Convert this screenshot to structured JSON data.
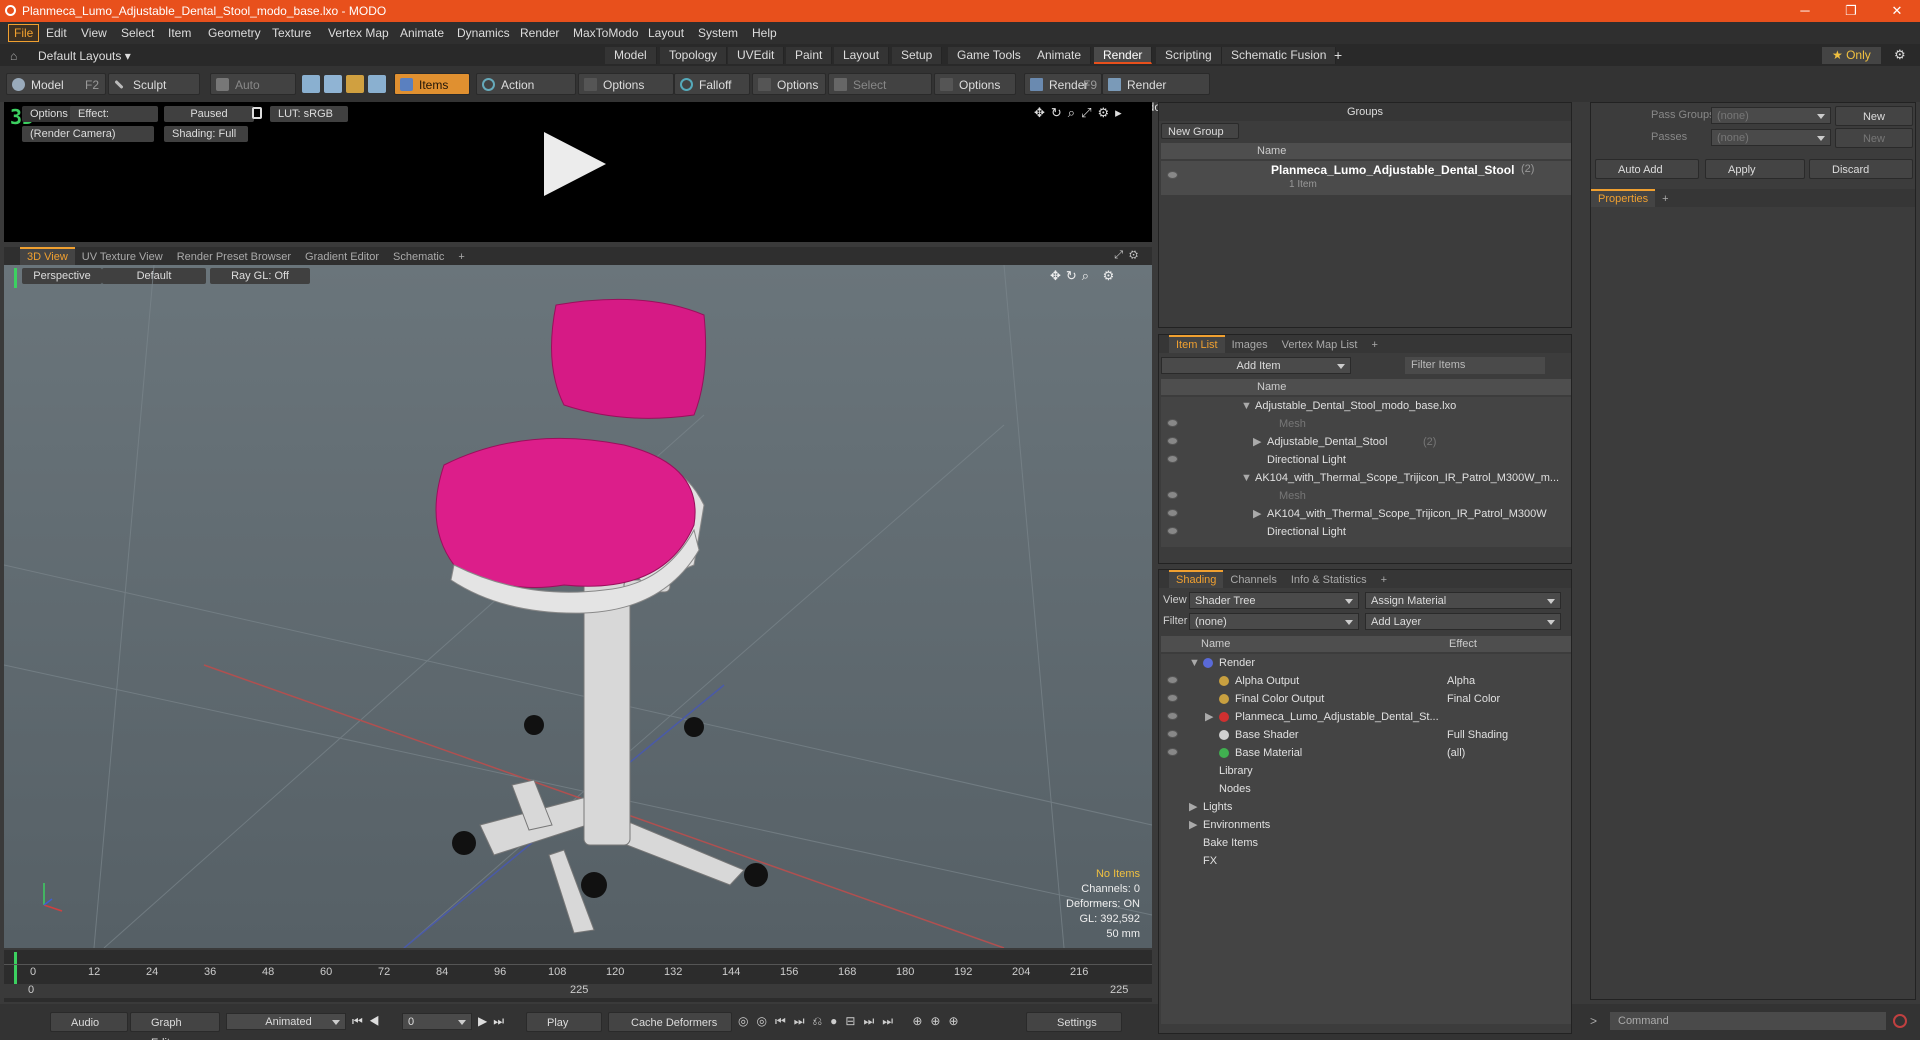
{
  "titlebar": {
    "title": "Planmeca_Lumo_Adjustable_Dental_Stool_modo_base.lxo - MODO",
    "min": "─",
    "max": "❐",
    "close": "✕"
  },
  "menu": [
    "File",
    "Edit",
    "View",
    "Select",
    "Item",
    "Geometry",
    "Texture",
    "Vertex Map",
    "Animate",
    "Dynamics",
    "Render",
    "MaxToModo",
    "Layout",
    "System",
    "Help"
  ],
  "layouts": {
    "label": "Default Layouts ▾",
    "tabs": [
      "Model",
      "Topology",
      "UVEdit",
      "Paint",
      "Layout",
      "Setup",
      "Game Tools",
      "Animate",
      "Render",
      "Scripting",
      "Schematic Fusion"
    ],
    "active": "Render",
    "only": "★ Only"
  },
  "toolbar": {
    "model": "Model",
    "model_key": "F2",
    "sculpt": "Sculpt",
    "auto_select": "Auto Select",
    "items": "Items",
    "action_center": "Action Center",
    "options1": "Options",
    "falloff": "Falloff",
    "options2": "Options",
    "select_through": "Select Through",
    "options3": "Options",
    "render": "Render",
    "render_key": "F9",
    "render_window": "Render Window"
  },
  "preview": {
    "options": "Options",
    "effect": "Effect: (Shadi...",
    "paused": "Paused",
    "lut": "LUT: sRGB",
    "camera": "(Render Camera)",
    "shading": "Shading: Full"
  },
  "viewtabs": [
    "3D View",
    "UV Texture View",
    "Render Preset Browser",
    "Gradient Editor",
    "Schematic"
  ],
  "viewport": {
    "perspective": "Perspective",
    "default": "Default",
    "raygl": "Ray GL: Off",
    "no_items": "No Items",
    "channels": "Channels: 0",
    "deformers": "Deformers: ON",
    "gl": "GL: 392,592",
    "mm": "50 mm"
  },
  "timeline": {
    "ticks": [
      "0",
      "12",
      "24",
      "36",
      "48",
      "60",
      "72",
      "84",
      "96",
      "108",
      "120",
      "132",
      "144",
      "156",
      "168",
      "180",
      "192",
      "204",
      "216"
    ],
    "start": "0",
    "mid": "225",
    "end": "225"
  },
  "bottombar": {
    "audio": "Audio",
    "graph": "Graph Editor",
    "animated": "Animated",
    "frame": "0",
    "play": "Play",
    "cache": "Cache Deformers",
    "settings": "Settings",
    "command": "Command"
  },
  "groups": {
    "title": "Groups",
    "new_group": "New Group",
    "name_col": "Name",
    "item_name": "Planmeca_Lumo_Adjustable_Dental_Stool",
    "item_count": "(2)",
    "item_sub": "1 Item"
  },
  "passes": {
    "pass_groups": "Pass Groups",
    "passes": "Passes",
    "none1": "(none)",
    "none2": "(none)",
    "new1": "New",
    "new2": "New",
    "auto_add": "Auto Add",
    "apply": "Apply",
    "discard": "Discard",
    "properties": "Properties"
  },
  "itemlist": {
    "tabs": [
      "Item List",
      "Images",
      "Vertex Map List"
    ],
    "add_item": "Add Item",
    "filter": "Filter Items",
    "name_col": "Name",
    "rows": [
      {
        "t": "Adjustable_Dental_Stool_modo_base.lxo",
        "lvl": 0,
        "arrow": "▼",
        "dim": false,
        "eye": false
      },
      {
        "t": "Mesh",
        "lvl": 2,
        "arrow": "",
        "dim": true,
        "eye": true
      },
      {
        "t": "Adjustable_Dental_Stool",
        "c": "(2)",
        "lvl": 1,
        "arrow": "▶",
        "dim": false,
        "eye": true
      },
      {
        "t": "Directional Light",
        "lvl": 1,
        "arrow": "",
        "dim": false,
        "eye": true
      },
      {
        "t": "AK104_with_Thermal_Scope_Trijicon_IR_Patrol_M300W_m...",
        "lvl": 0,
        "arrow": "▼",
        "dim": false,
        "eye": false
      },
      {
        "t": "Mesh",
        "lvl": 2,
        "arrow": "",
        "dim": true,
        "eye": true
      },
      {
        "t": "AK104_with_Thermal_Scope_Trijicon_IR_Patrol_M300W",
        "lvl": 1,
        "arrow": "▶",
        "dim": false,
        "eye": true
      },
      {
        "t": "Directional Light",
        "lvl": 1,
        "arrow": "",
        "dim": false,
        "eye": true
      }
    ]
  },
  "shading": {
    "tabs": [
      "Shading",
      "Channels",
      "Info & Statistics"
    ],
    "view_label": "View",
    "view_value": "Shader Tree",
    "assign": "Assign Material",
    "filter_label": "Filter",
    "filter_value": "(none)",
    "add_layer": "Add Layer",
    "name_col": "Name",
    "effect_col": "Effect",
    "rows": [
      {
        "t": "Render",
        "e": "",
        "lvl": 0,
        "arrow": "▼",
        "eye": false,
        "dot": "#5a6ad8"
      },
      {
        "t": "Alpha Output",
        "e": "Alpha",
        "lvl": 1,
        "arrow": "",
        "eye": true,
        "dot": "#c8a040"
      },
      {
        "t": "Final Color Output",
        "e": "Final Color",
        "lvl": 1,
        "arrow": "",
        "eye": true,
        "dot": "#c8a040"
      },
      {
        "t": "Planmeca_Lumo_Adjustable_Dental_St...",
        "e": "",
        "lvl": 1,
        "arrow": "▶",
        "eye": true,
        "dot": "#d03030"
      },
      {
        "t": "Base Shader",
        "e": "Full Shading",
        "lvl": 1,
        "arrow": "",
        "eye": true,
        "dot": "#d0d0d0"
      },
      {
        "t": "Base Material",
        "e": "(all)",
        "lvl": 1,
        "arrow": "",
        "eye": true,
        "dot": "#40b050"
      },
      {
        "t": "Library",
        "e": "",
        "lvl": 1,
        "arrow": "",
        "eye": false,
        "dot": ""
      },
      {
        "t": "Nodes",
        "e": "",
        "lvl": 1,
        "arrow": "",
        "eye": false,
        "dot": ""
      },
      {
        "t": "Lights",
        "e": "",
        "lvl": 0,
        "arrow": "▶",
        "eye": false,
        "dot": ""
      },
      {
        "t": "Environments",
        "e": "",
        "lvl": 0,
        "arrow": "▶",
        "eye": false,
        "dot": ""
      },
      {
        "t": "Bake Items",
        "e": "",
        "lvl": 0,
        "arrow": "",
        "eye": false,
        "dot": ""
      },
      {
        "t": "FX",
        "e": "",
        "lvl": 0,
        "arrow": "",
        "eye": false,
        "dot": ""
      }
    ]
  }
}
